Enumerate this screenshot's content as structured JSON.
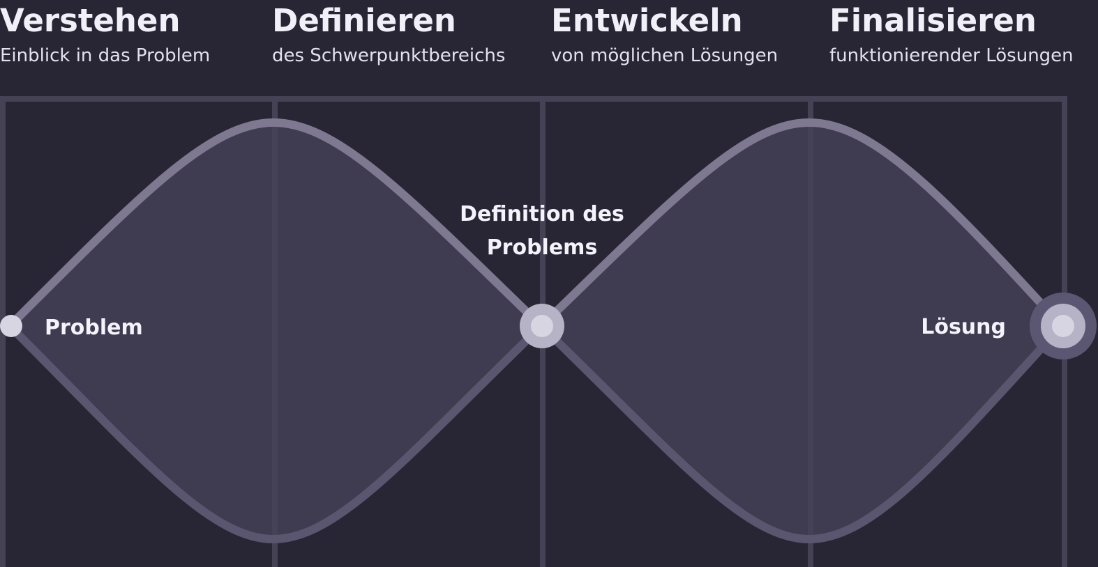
{
  "phases": [
    {
      "title": "Verstehen",
      "subtitle": "Einblick in das Problem"
    },
    {
      "title": "Definieren",
      "subtitle": "des Schwerpunktbereichs"
    },
    {
      "title": "Entwickeln",
      "subtitle": "von möglichen Lösungen"
    },
    {
      "title": "Finalisieren",
      "subtitle": "funktionierender Lösungen"
    }
  ],
  "nodes": {
    "start": "Problem",
    "middle_line1": "Definition des",
    "middle_line2": "Problems",
    "end": "Lösung"
  },
  "colors": {
    "background": "#282634",
    "grid": "#454255",
    "diamond_fill": "#403c52",
    "curve_top": "#7e7991",
    "curve_bottom": "#5a566f",
    "node_inner": "#d8d5e2",
    "node_ring": "#b7b3c7",
    "node_ring_outer": "#5b5772",
    "text": "#f1eff7"
  }
}
